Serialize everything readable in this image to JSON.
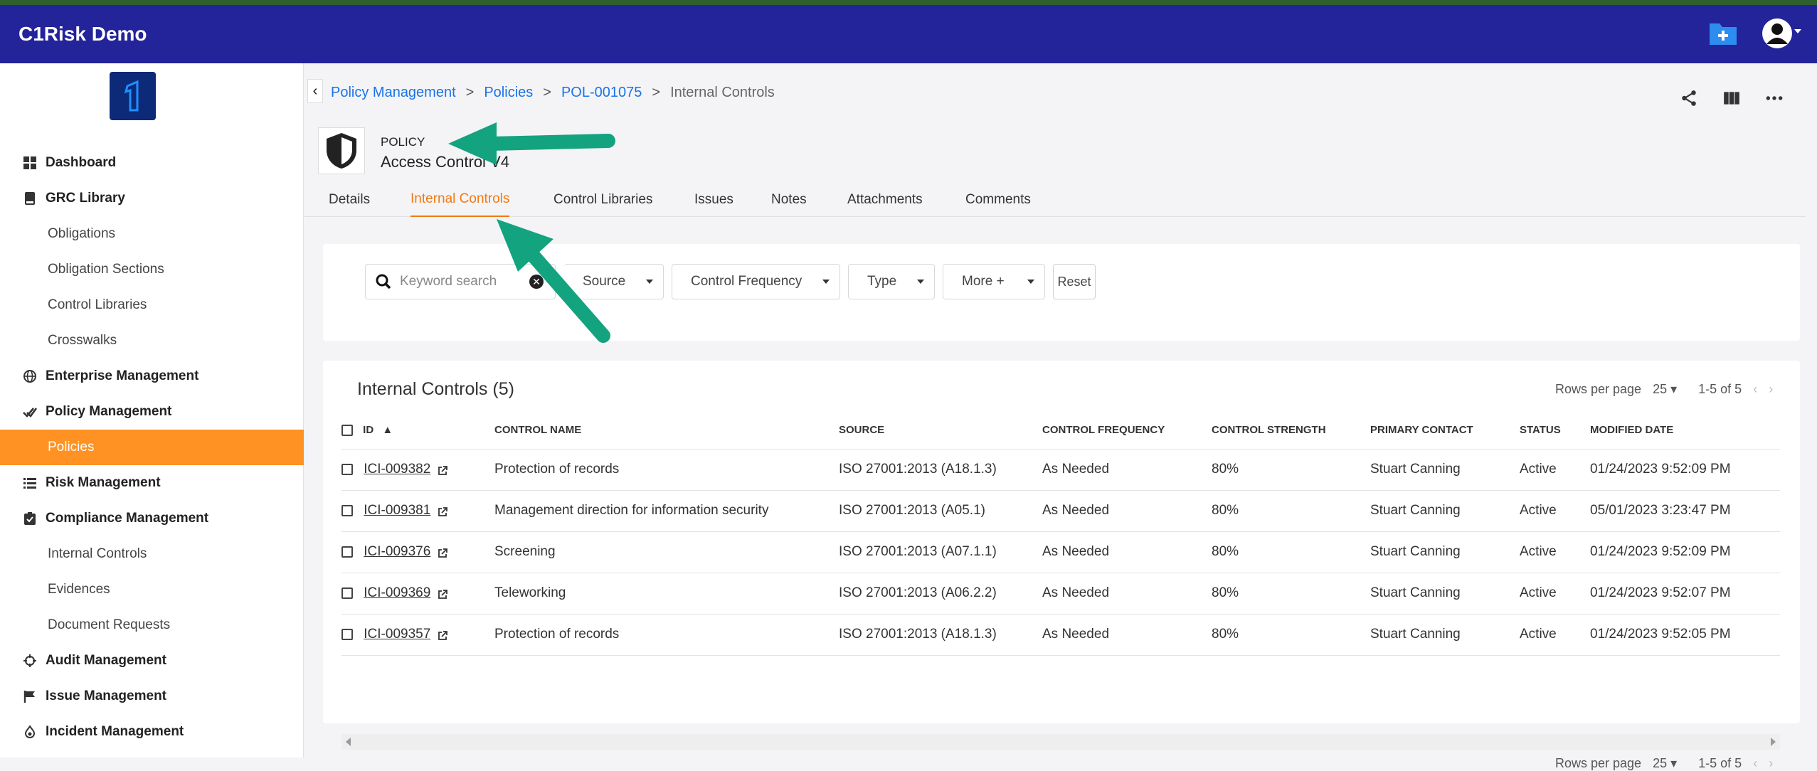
{
  "app": {
    "title": "C1Risk Demo"
  },
  "sidebar": {
    "items": [
      {
        "label": "Dashboard",
        "level": "top",
        "icon": "dashboard-icon"
      },
      {
        "label": "GRC Library",
        "level": "top",
        "icon": "book-icon"
      },
      {
        "label": "Obligations",
        "level": "sub"
      },
      {
        "label": "Obligation Sections",
        "level": "sub"
      },
      {
        "label": "Control Libraries",
        "level": "sub"
      },
      {
        "label": "Crosswalks",
        "level": "sub"
      },
      {
        "label": "Enterprise Management",
        "level": "top",
        "icon": "globe-icon"
      },
      {
        "label": "Policy Management",
        "level": "top",
        "icon": "double-check-icon"
      },
      {
        "label": "Policies",
        "level": "sub",
        "active": true
      },
      {
        "label": "Risk Management",
        "level": "top",
        "icon": "list-icon"
      },
      {
        "label": "Compliance Management",
        "level": "top",
        "icon": "clipboard-check-icon"
      },
      {
        "label": "Internal Controls",
        "level": "sub"
      },
      {
        "label": "Evidences",
        "level": "sub"
      },
      {
        "label": "Document Requests",
        "level": "sub"
      },
      {
        "label": "Audit Management",
        "level": "top",
        "icon": "crosshair-icon"
      },
      {
        "label": "Issue Management",
        "level": "top",
        "icon": "flag-icon"
      },
      {
        "label": "Incident Management",
        "level": "top",
        "icon": "fire-icon"
      }
    ]
  },
  "breadcrumb": {
    "b1": "Policy Management",
    "b2": "Policies",
    "b3": "POL-001075",
    "b4": "Internal Controls",
    "sep": ">"
  },
  "record": {
    "type": "POLICY",
    "name": "Access Control V4"
  },
  "tabs": {
    "details": "Details",
    "internal_controls": "Internal Controls",
    "control_libraries": "Control Libraries",
    "issues": "Issues",
    "notes": "Notes",
    "attachments": "Attachments",
    "comments": "Comments"
  },
  "filters": {
    "search_placeholder": "Keyword search",
    "source": "Source",
    "frequency": "Control Frequency",
    "type": "Type",
    "more": "More +",
    "reset": "Reset"
  },
  "panel": {
    "title": "Internal Controls (5)",
    "rows_per_page_label": "Rows per page",
    "rows_per_page": "25",
    "range": "1-5 of 5"
  },
  "table": {
    "headers": {
      "id": "ID",
      "name": "CONTROL NAME",
      "source": "SOURCE",
      "frequency": "CONTROL FREQUENCY",
      "strength": "CONTROL STRENGTH",
      "contact": "PRIMARY CONTACT",
      "status": "STATUS",
      "modified": "MODIFIED DATE"
    },
    "rows": [
      {
        "id": "ICI-009382",
        "name": "Protection of records",
        "source": "ISO 27001:2013 (A18.1.3)",
        "frequency": "As Needed",
        "strength": "80%",
        "contact": "Stuart Canning",
        "status": "Active",
        "modified": "01/24/2023 9:52:09 PM"
      },
      {
        "id": "ICI-009381",
        "name": "Management direction for information security",
        "source": "ISO 27001:2013 (A05.1)",
        "frequency": "As Needed",
        "strength": "80%",
        "contact": "Stuart Canning",
        "status": "Active",
        "modified": "05/01/2023 3:23:47 PM"
      },
      {
        "id": "ICI-009376",
        "name": "Screening",
        "source": "ISO 27001:2013 (A07.1.1)",
        "frequency": "As Needed",
        "strength": "80%",
        "contact": "Stuart Canning",
        "status": "Active",
        "modified": "01/24/2023 9:52:09 PM"
      },
      {
        "id": "ICI-009369",
        "name": "Teleworking",
        "source": "ISO 27001:2013 (A06.2.2)",
        "frequency": "As Needed",
        "strength": "80%",
        "contact": "Stuart Canning",
        "status": "Active",
        "modified": "01/24/2023 9:52:07 PM"
      },
      {
        "id": "ICI-009357",
        "name": "Protection of records",
        "source": "ISO 27001:2013 (A18.1.3)",
        "frequency": "As Needed",
        "strength": "80%",
        "contact": "Stuart Canning",
        "status": "Active",
        "modified": "01/24/2023 9:52:05 PM"
      }
    ]
  },
  "colors": {
    "appbar": "#23239a",
    "accent": "#ff9222",
    "link": "#1a73e8",
    "annotation_arrow": "#14a37f"
  }
}
